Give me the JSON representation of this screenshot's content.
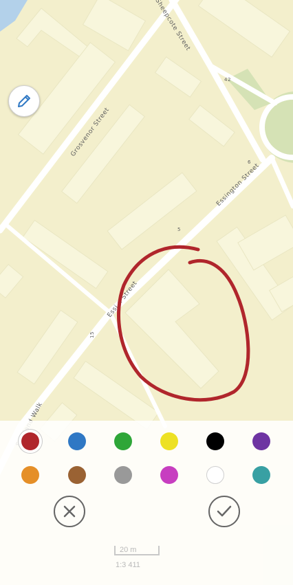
{
  "map": {
    "streets": {
      "grosvenor": "Grosvenor Street",
      "essington": "Essington Street",
      "essington_cut": "Essi    n    Street",
      "sheepcote": "Sheepcote Street",
      "scotland_walk": "Scotland Walk"
    },
    "house_numbers": [
      "42",
      "5",
      "15",
      "6"
    ],
    "colors": {
      "land": "#f3efcc",
      "building": "#f8f6dc",
      "road": "#ffffff",
      "park": "#d5e2b5",
      "water": "#b3d1ea",
      "drawing": "#b0262c"
    }
  },
  "drawing_tool": {
    "edit_icon": "pencil-icon",
    "colors": [
      {
        "name": "red",
        "hex": "#b0262c",
        "selected": true
      },
      {
        "name": "blue",
        "hex": "#2f78c4",
        "selected": false
      },
      {
        "name": "green",
        "hex": "#2ea638",
        "selected": false
      },
      {
        "name": "yellow",
        "hex": "#ede124",
        "selected": false
      },
      {
        "name": "black",
        "hex": "#000000",
        "selected": false
      },
      {
        "name": "purple",
        "hex": "#6e34a2",
        "selected": false
      },
      {
        "name": "orange",
        "hex": "#e58f28",
        "selected": false
      },
      {
        "name": "brown",
        "hex": "#9a6233",
        "selected": false
      },
      {
        "name": "gray",
        "hex": "#999999",
        "selected": false
      },
      {
        "name": "magenta",
        "hex": "#c73ec0",
        "selected": false
      },
      {
        "name": "white",
        "hex": "#ffffff",
        "selected": false
      },
      {
        "name": "teal",
        "hex": "#38a0a3",
        "selected": false
      }
    ],
    "cancel_icon": "close-circle-icon",
    "confirm_icon": "check-circle-icon"
  },
  "scale": {
    "distance": "20 m",
    "ratio": "1:3 411"
  }
}
